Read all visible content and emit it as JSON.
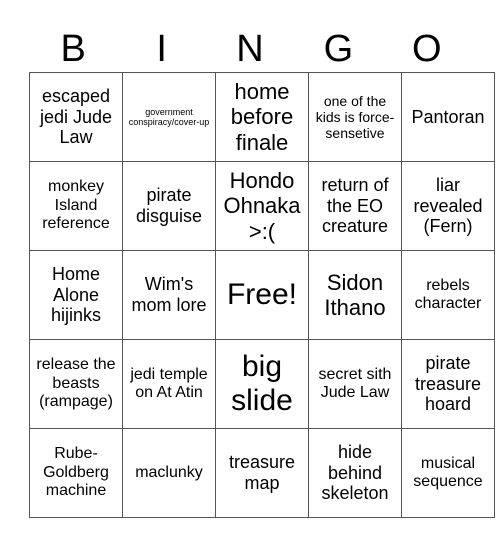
{
  "header": [
    "B",
    "I",
    "N",
    "G",
    "O"
  ],
  "rows": [
    [
      {
        "text": "escaped jedi Jude Law",
        "size": "s-lg"
      },
      {
        "text": "government conspiracy/cover-up",
        "size": "s-tiny"
      },
      {
        "text": "home before finale",
        "size": "s-xl"
      },
      {
        "text": "one of the kids is force-sensetive",
        "size": "s-sm"
      },
      {
        "text": "Pantoran",
        "size": "s-lg"
      }
    ],
    [
      {
        "text": "monkey Island reference",
        "size": "s-md"
      },
      {
        "text": "pirate disguise",
        "size": "s-lg"
      },
      {
        "text": "Hondo Ohnaka >:(",
        "size": "s-xl"
      },
      {
        "text": "return of the EO creature",
        "size": "s-lg"
      },
      {
        "text": "liar revealed (Fern)",
        "size": "s-lg"
      }
    ],
    [
      {
        "text": "Home Alone hijinks",
        "size": "s-lg"
      },
      {
        "text": "Wim's mom lore",
        "size": "s-lg"
      },
      {
        "text": "Free!",
        "size": "s-free"
      },
      {
        "text": "Sidon Ithano",
        "size": "s-xl"
      },
      {
        "text": "rebels character",
        "size": "s-md"
      }
    ],
    [
      {
        "text": "release the beasts (rampage)",
        "size": "s-md"
      },
      {
        "text": "jedi temple on At Atin",
        "size": "s-md"
      },
      {
        "text": "big slide",
        "size": "s-xxl"
      },
      {
        "text": "secret sith Jude Law",
        "size": "s-md"
      },
      {
        "text": "pirate treasure hoard",
        "size": "s-lg"
      }
    ],
    [
      {
        "text": "Rube-Goldberg machine",
        "size": "s-md"
      },
      {
        "text": "maclunky",
        "size": "s-md"
      },
      {
        "text": "treasure map",
        "size": "s-lg"
      },
      {
        "text": "hide behind skeleton",
        "size": "s-lg"
      },
      {
        "text": "musical sequence",
        "size": "s-md"
      }
    ]
  ]
}
